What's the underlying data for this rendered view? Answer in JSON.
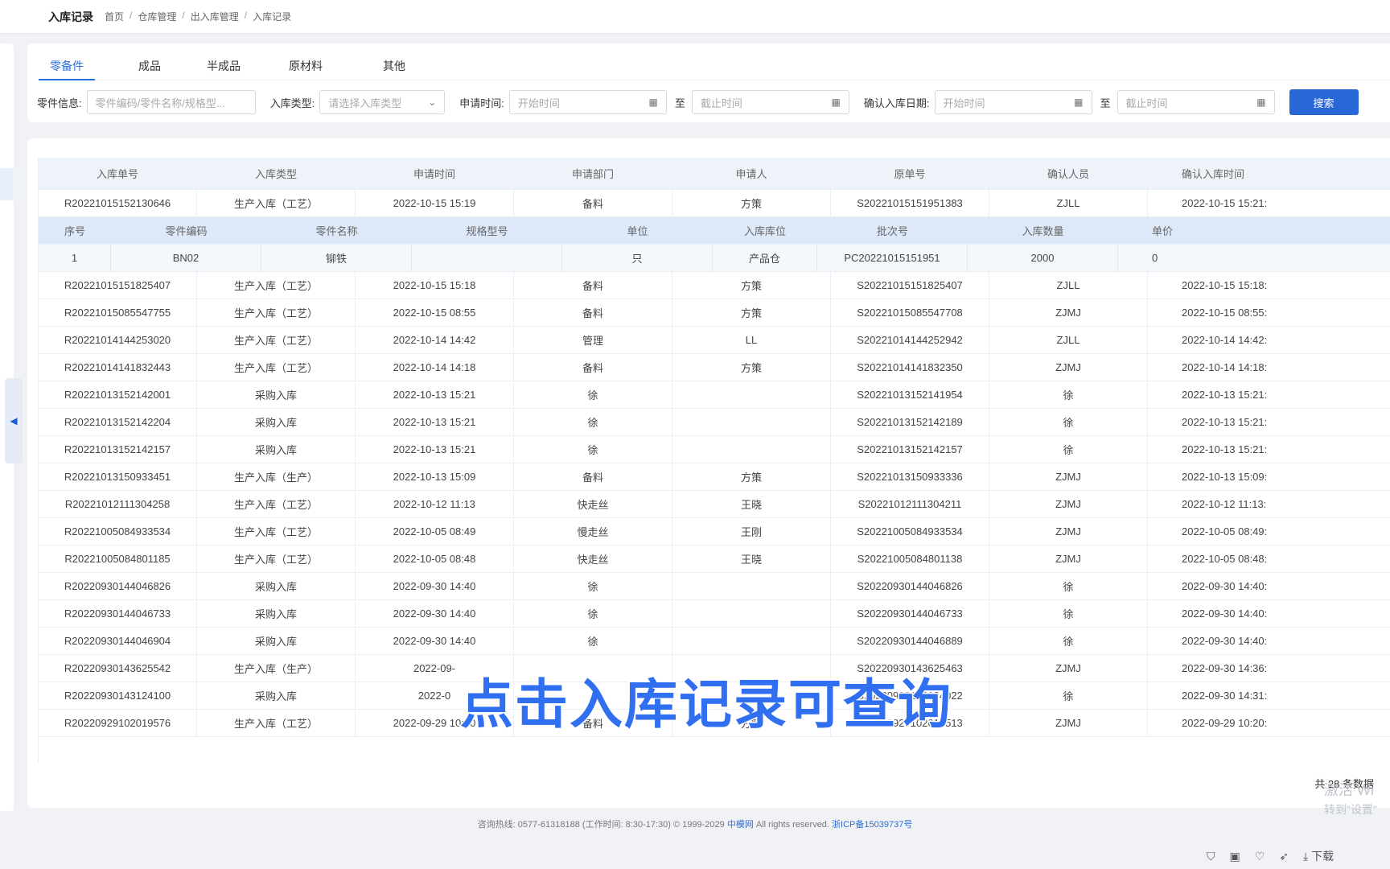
{
  "header": {
    "title": "入库记录",
    "breadcrumb": [
      "首页",
      "仓库管理",
      "出入库管理",
      "入库记录"
    ]
  },
  "tabs": [
    "零备件",
    "成品",
    "半成品",
    "原材料",
    "其他"
  ],
  "filters": {
    "part_info_label": "零件信息:",
    "part_info_placeholder": "零件编码/零件名称/规格型...",
    "type_label": "入库类型:",
    "type_placeholder": "请选择入库类型",
    "apply_time_label": "申请时间:",
    "start_placeholder": "开始时间",
    "to_label": "至",
    "end_placeholder": "截止时间",
    "confirm_date_label": "确认入库日期:",
    "confirm_start_placeholder": "开始时间",
    "confirm_end_placeholder": "截止时间",
    "search_label": "搜索"
  },
  "table": {
    "columns": [
      "入库单号",
      "入库类型",
      "申请时间",
      "申请部门",
      "申请人",
      "原单号",
      "确认人员",
      "确认入库时间"
    ],
    "first_row": [
      "R20221015152130646",
      "生产入库（工艺）",
      "2022-10-15 15:19",
      "备料",
      "方策",
      "S20221015151951383",
      "ZJLL",
      "2022-10-15 15:21:"
    ],
    "sub_columns": [
      "序号",
      "零件编码",
      "零件名称",
      "规格型号",
      "单位",
      "入库库位",
      "批次号",
      "入库数量",
      "单价"
    ],
    "sub_rows": [
      [
        "1",
        "BN02",
        "铆铁",
        "",
        "只",
        "产品仓",
        "PC20221015151951",
        "2000",
        "0"
      ]
    ],
    "rows": [
      [
        "R20221015151825407",
        "生产入库（工艺）",
        "2022-10-15 15:18",
        "备料",
        "方策",
        "S20221015151825407",
        "ZJLL",
        "2022-10-15 15:18:"
      ],
      [
        "R20221015085547755",
        "生产入库（工艺）",
        "2022-10-15 08:55",
        "备料",
        "方策",
        "S20221015085547708",
        "ZJMJ",
        "2022-10-15 08:55:"
      ],
      [
        "R20221014144253020",
        "生产入库（工艺）",
        "2022-10-14 14:42",
        "管理",
        "LL",
        "S20221014144252942",
        "ZJLL",
        "2022-10-14 14:42:"
      ],
      [
        "R20221014141832443",
        "生产入库（工艺）",
        "2022-10-14 14:18",
        "备料",
        "方策",
        "S20221014141832350",
        "ZJMJ",
        "2022-10-14 14:18:"
      ],
      [
        "R20221013152142001",
        "采购入库",
        "2022-10-13 15:21",
        "徐",
        "",
        "S20221013152141954",
        "徐",
        "2022-10-13 15:21:"
      ],
      [
        "R20221013152142204",
        "采购入库",
        "2022-10-13 15:21",
        "徐",
        "",
        "S20221013152142189",
        "徐",
        "2022-10-13 15:21:"
      ],
      [
        "R20221013152142157",
        "采购入库",
        "2022-10-13 15:21",
        "徐",
        "",
        "S20221013152142157",
        "徐",
        "2022-10-13 15:21:"
      ],
      [
        "R20221013150933451",
        "生产入库（生产）",
        "2022-10-13 15:09",
        "备料",
        "方策",
        "S20221013150933336",
        "ZJMJ",
        "2022-10-13 15:09:"
      ],
      [
        "R20221012111304258",
        "生产入库（工艺）",
        "2022-10-12 11:13",
        "快走丝",
        "王晓",
        "S20221012111304211",
        "ZJMJ",
        "2022-10-12 11:13:"
      ],
      [
        "R20221005084933534",
        "生产入库（工艺）",
        "2022-10-05 08:49",
        "慢走丝",
        "王刚",
        "S20221005084933534",
        "ZJMJ",
        "2022-10-05 08:49:"
      ],
      [
        "R20221005084801185",
        "生产入库（工艺）",
        "2022-10-05 08:48",
        "快走丝",
        "王晓",
        "S20221005084801138",
        "ZJMJ",
        "2022-10-05 08:48:"
      ],
      [
        "R20220930144046826",
        "采购入库",
        "2022-09-30 14:40",
        "徐",
        "",
        "S20220930144046826",
        "徐",
        "2022-09-30 14:40:"
      ],
      [
        "R20220930144046733",
        "采购入库",
        "2022-09-30 14:40",
        "徐",
        "",
        "S20220930144046733",
        "徐",
        "2022-09-30 14:40:"
      ],
      [
        "R20220930144046904",
        "采购入库",
        "2022-09-30 14:40",
        "徐",
        "",
        "S20220930144046889",
        "徐",
        "2022-09-30 14:40:"
      ],
      [
        "R20220930143625542",
        "生产入库（生产）",
        "2022-09-",
        "",
        "",
        "S20220930143625463",
        "ZJMJ",
        "2022-09-30 14:36:"
      ],
      [
        "R20220930143124100",
        "采购入库",
        "2022-0",
        "",
        "",
        "S20220930143124022",
        "徐",
        "2022-09-30 14:31:"
      ],
      [
        "R20220929102019576",
        "生产入库（工艺）",
        "2022-09-29 10:20",
        "备料",
        "方策",
        "S20220929102019513",
        "ZJMJ",
        "2022-09-29 10:20:"
      ]
    ]
  },
  "pager": {
    "total_text": "共 28 条数据"
  },
  "footer": {
    "text": "咨询热线: 0577-61318188 (工作时间: 8:30-17:30) © 1999-2029",
    "brand": "中模网",
    "rights": "All rights reserved.",
    "icp": "浙ICP备15039737号"
  },
  "overlay": {
    "subtitle": "点击入库记录可查询"
  },
  "watermark": {
    "line1": "激活 Wi",
    "line2": "转到\"设置\""
  },
  "taskbar": {
    "download": "下载"
  },
  "colors": {
    "accent": "#2a6fdb",
    "button": "#2867d6",
    "header_bg": "#eef2f9",
    "subheader_bg": "#dde8f9"
  }
}
